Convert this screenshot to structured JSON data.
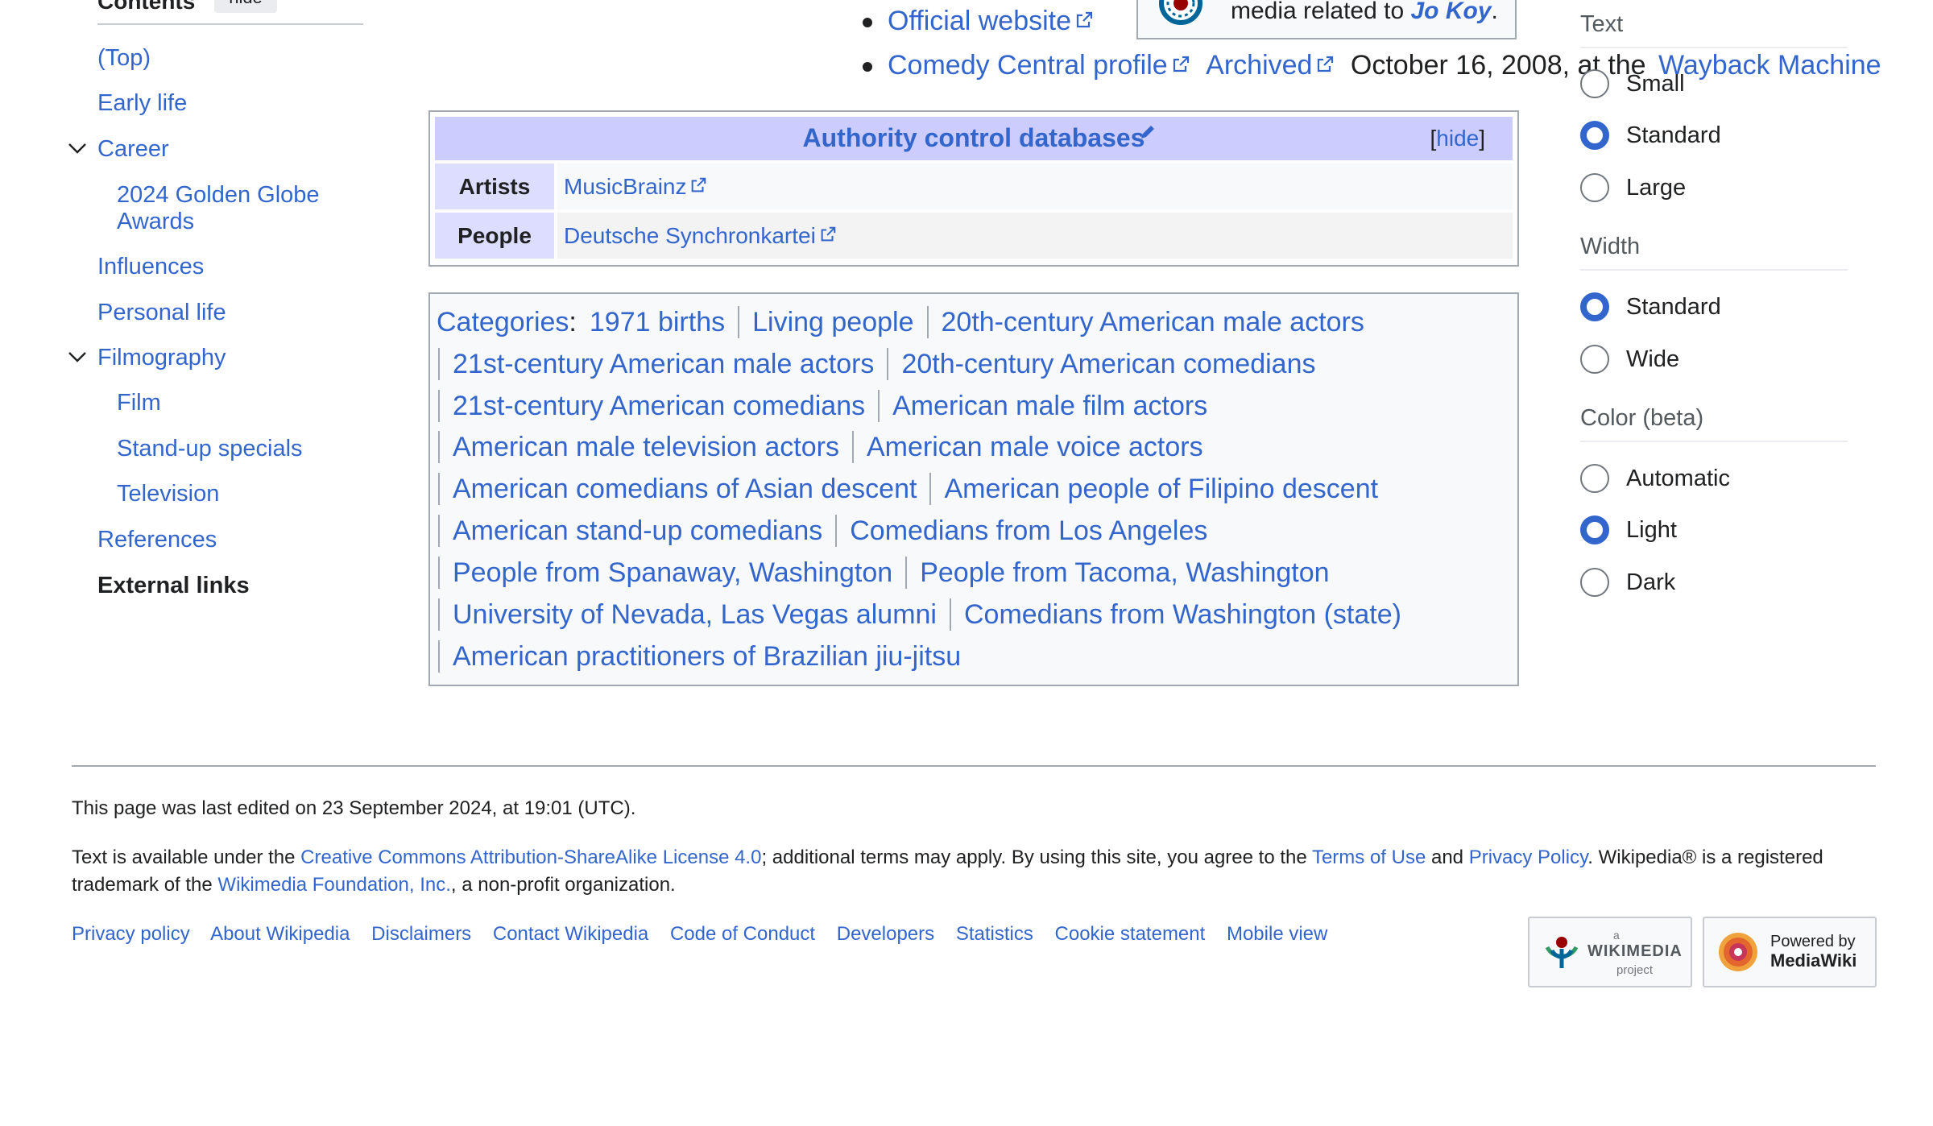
{
  "toc": {
    "title": "Contents",
    "hide_label": "hide",
    "items": [
      {
        "label": "(Top)"
      },
      {
        "label": "Early life"
      },
      {
        "label": "Career"
      },
      {
        "label": "2024 Golden Globe Awards"
      },
      {
        "label": "Influences"
      },
      {
        "label": "Personal life"
      },
      {
        "label": "Filmography"
      },
      {
        "label": "Film"
      },
      {
        "label": "Stand-up specials"
      },
      {
        "label": "Television"
      },
      {
        "label": "References"
      },
      {
        "label": "External links"
      }
    ],
    "sub_2024_line1": "2024 Golden Globe",
    "sub_2024_line2": "Awards"
  },
  "external_links": {
    "official": "Official website",
    "comedy_central": "Comedy Central profile",
    "archived": "Archived",
    "archived_date": "October 16, 2008, at the",
    "wayback": "Wayback Machine"
  },
  "commons": {
    "text": "media related to",
    "subject": "Jo Koy",
    "period": "."
  },
  "authority": {
    "title": "Authority control databases",
    "hide_label": "hide",
    "rows": [
      {
        "label": "Artists",
        "value": "MusicBrainz"
      },
      {
        "label": "People",
        "value": "Deutsche Synchronkartei"
      }
    ]
  },
  "categories": {
    "heading": "Categories",
    "colon": ":",
    "lines": [
      [
        "1971 births",
        "Living people",
        "20th-century American male actors"
      ],
      [
        "21st-century American male actors",
        "20th-century American comedians"
      ],
      [
        "21st-century American comedians",
        "American male film actors"
      ],
      [
        "American male television actors",
        "American male voice actors"
      ],
      [
        "American comedians of Asian descent",
        "American people of Filipino descent"
      ],
      [
        "American stand-up comedians",
        "Comedians from Los Angeles"
      ],
      [
        "People from Spanaway, Washington",
        "People from Tacoma, Washington"
      ],
      [
        "University of Nevada, Las Vegas alumni",
        "Comedians from Washington (state)"
      ],
      [
        "American practitioners of Brazilian jiu-jitsu"
      ]
    ]
  },
  "appearance": {
    "text_title": "Text",
    "text_options": [
      "Small",
      "Standard",
      "Large"
    ],
    "text_selected": "Standard",
    "width_title": "Width",
    "width_options": [
      "Standard",
      "Wide"
    ],
    "width_selected": "Standard",
    "color_title": "Color (beta)",
    "color_options": [
      "Automatic",
      "Light",
      "Dark"
    ],
    "color_selected": "Light"
  },
  "footer": {
    "last_edited": "This page was last edited on 23 September 2024, at 19:01 (UTC).",
    "license_pre": "Text is available under the ",
    "license_link": "Creative Commons Attribution-ShareAlike License 4.0",
    "license_mid": "; additional terms may apply. By using this site, you agree to the ",
    "terms_link": "Terms of Use",
    "and": " and ",
    "privacy_link": "Privacy Policy",
    "license_post": ". Wikipedia® is a registered trademark of the ",
    "wmf_link": "Wikimedia Foundation, Inc.",
    "license_end": ", a non-profit organization.",
    "nav": [
      "Privacy policy",
      "About Wikipedia",
      "Disclaimers",
      "Contact Wikipedia",
      "Code of Conduct",
      "Developers",
      "Statistics",
      "Cookie statement",
      "Mobile view"
    ],
    "wikimedia_badge": {
      "small": "a",
      "name": "WIKIMEDIA",
      "sub": "project"
    },
    "mediawiki_badge": {
      "line1": "Powered by",
      "line2": "MediaWiki"
    }
  },
  "colors": {
    "link": "#3366cc",
    "text": "#202122",
    "authority_header": "#ccccff",
    "authority_label": "#ddddff"
  }
}
